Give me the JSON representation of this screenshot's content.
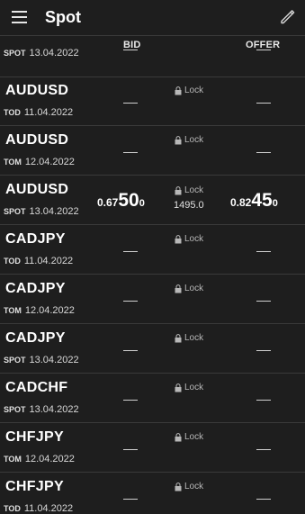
{
  "header": {
    "title": "Spot",
    "menu_icon": "hamburger-menu-icon",
    "edit_icon": "pencil-edit-icon"
  },
  "columns": {
    "bid": "BID",
    "offer": "OFFER"
  },
  "lock_label": "Lock",
  "rows": [
    {
      "symbol": "",
      "tenor": "SPOT",
      "date": "13.04.2022"
    },
    {
      "symbol": "AUDUSD",
      "tenor": "TOD",
      "date": "11.04.2022"
    },
    {
      "symbol": "AUDUSD",
      "tenor": "TOM",
      "date": "12.04.2022"
    },
    {
      "symbol": "AUDUSD",
      "tenor": "SPOT",
      "date": "13.04.2022",
      "bid": {
        "prefix": "0.67",
        "big": "50",
        "pip": "0"
      },
      "offer": {
        "prefix": "0.82",
        "big": "45",
        "pip": "0"
      },
      "spread": "1495.0"
    },
    {
      "symbol": "CADJPY",
      "tenor": "TOD",
      "date": "11.04.2022"
    },
    {
      "symbol": "CADJPY",
      "tenor": "TOM",
      "date": "12.04.2022"
    },
    {
      "symbol": "CADJPY",
      "tenor": "SPOT",
      "date": "13.04.2022"
    },
    {
      "symbol": "CADCHF",
      "tenor": "SPOT",
      "date": "13.04.2022"
    },
    {
      "symbol": "CHFJPY",
      "tenor": "TOM",
      "date": "12.04.2022"
    },
    {
      "symbol": "CHFJPY",
      "tenor": "TOD",
      "date": "11.04.2022"
    }
  ],
  "colors": {
    "background": "#1e1e1e",
    "divider": "#3a3a3a",
    "text": "#ffffff"
  }
}
